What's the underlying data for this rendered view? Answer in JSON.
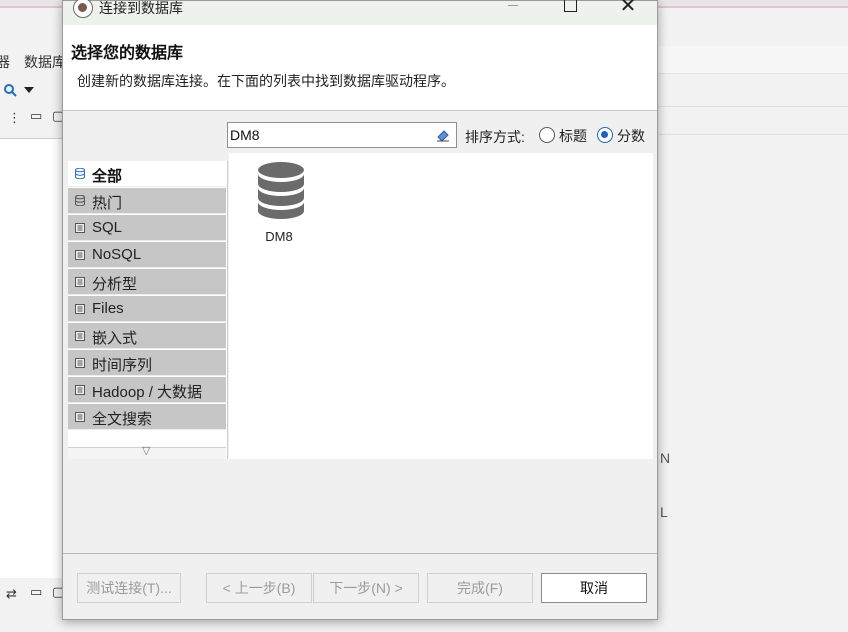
{
  "background": {
    "menu_fragment_1": "器",
    "menu_fragment_2": "数据库",
    "letter_n": "N",
    "letter_l": "L"
  },
  "dialog": {
    "window_title": "连接到数据库",
    "header_title": "选择您的数据库",
    "header_desc": "创建新的数据库连接。在下面的列表中找到数据库驱动程序。",
    "search_value": "DM8",
    "sort_label": "排序方式:",
    "sort_options": [
      {
        "label": "标题",
        "checked": false
      },
      {
        "label": "分数",
        "checked": true
      }
    ],
    "categories": [
      {
        "label": "全部",
        "active": true
      },
      {
        "label": "热门",
        "active": false
      },
      {
        "label": "SQL",
        "active": false
      },
      {
        "label": "NoSQL",
        "active": false
      },
      {
        "label": "分析型",
        "active": false
      },
      {
        "label": "Files",
        "active": false
      },
      {
        "label": "嵌入式",
        "active": false
      },
      {
        "label": "时间序列",
        "active": false
      },
      {
        "label": "Hadoop / 大数据",
        "active": false
      },
      {
        "label": "全文搜索",
        "active": false
      }
    ],
    "databases": [
      {
        "label": "DM8",
        "icon": "database-icon"
      }
    ],
    "buttons": {
      "test": "测试连接(T)...",
      "prev": "< 上一步(B)",
      "next": "下一步(N) >",
      "finish": "完成(F)",
      "cancel": "取消"
    }
  }
}
